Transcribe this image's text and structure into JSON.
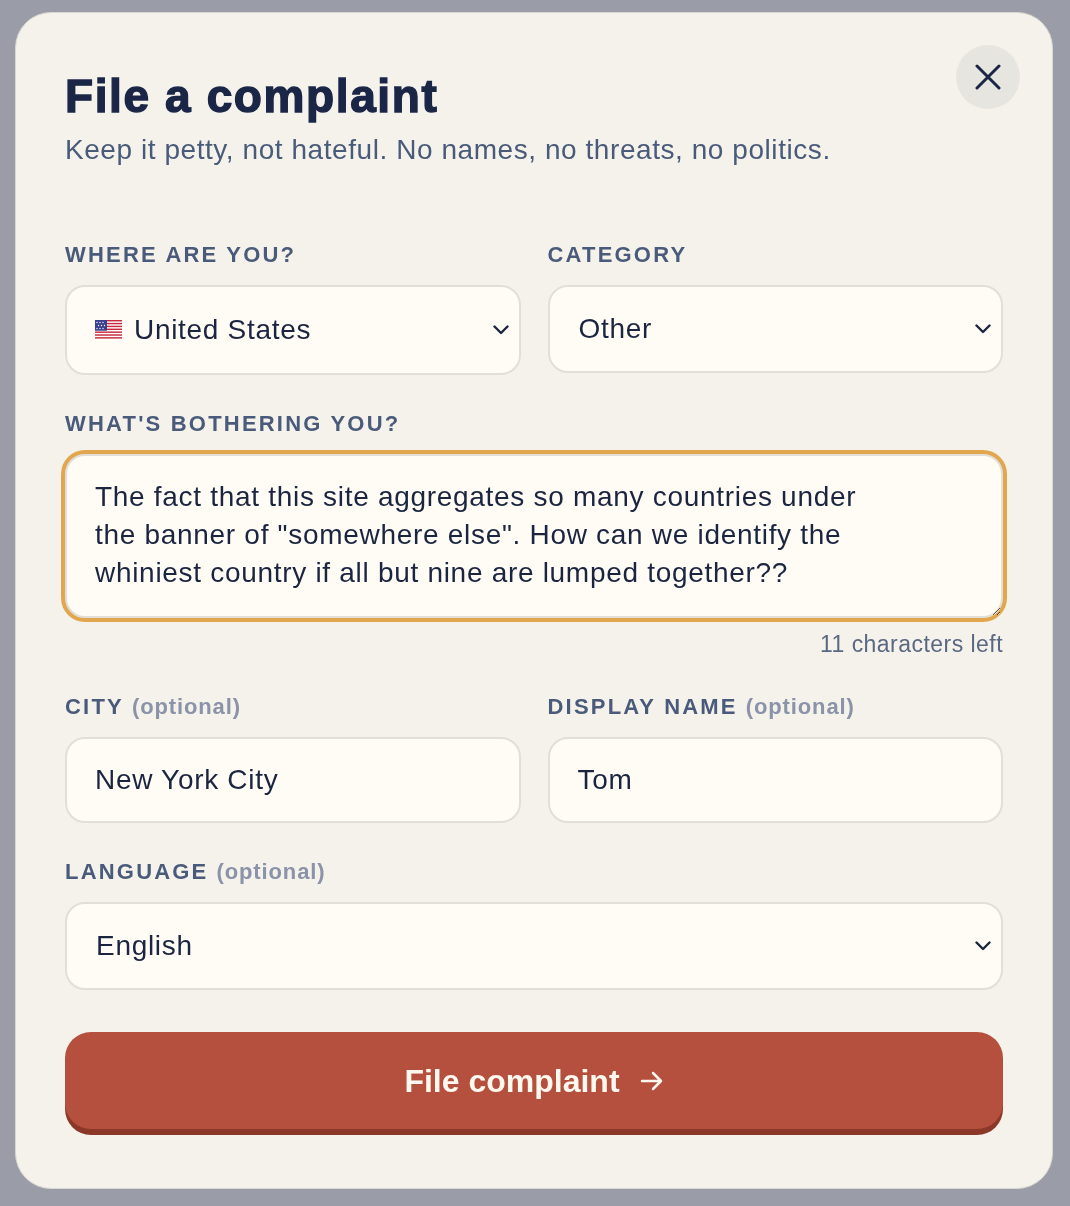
{
  "dialog": {
    "title": "File a complaint",
    "subtitle": "Keep it petty, not hateful. No names, no threats, no politics."
  },
  "rows": [
    [
      {
        "kind": "country-select",
        "label": "WHERE ARE YOU?",
        "value": "United States",
        "focused": false
      },
      {
        "kind": "select",
        "label": "CATEGORY",
        "value": "Other",
        "focused": false
      }
    ],
    [
      {
        "kind": "textarea",
        "label": "WHAT'S BOTHERING YOU?",
        "value": "The fact that this site aggregates so many countries under the banner of \"somewhere else\". How can we identify the whiniest country if all but nine are lumped together??",
        "counter": "11 characters left",
        "focused": true
      }
    ],
    [
      {
        "kind": "text",
        "label": "CITY",
        "hint": "(optional)",
        "value": "New York City",
        "focused": false
      },
      {
        "kind": "text",
        "label": "DISPLAY NAME",
        "hint": "(optional)",
        "value": "Tom",
        "focused": false
      }
    ],
    [
      {
        "kind": "select",
        "label": "LANGUAGE",
        "hint": "(optional)",
        "value": "English",
        "focused": false
      }
    ]
  ],
  "submit_button": {
    "label": "File complaint"
  }
}
